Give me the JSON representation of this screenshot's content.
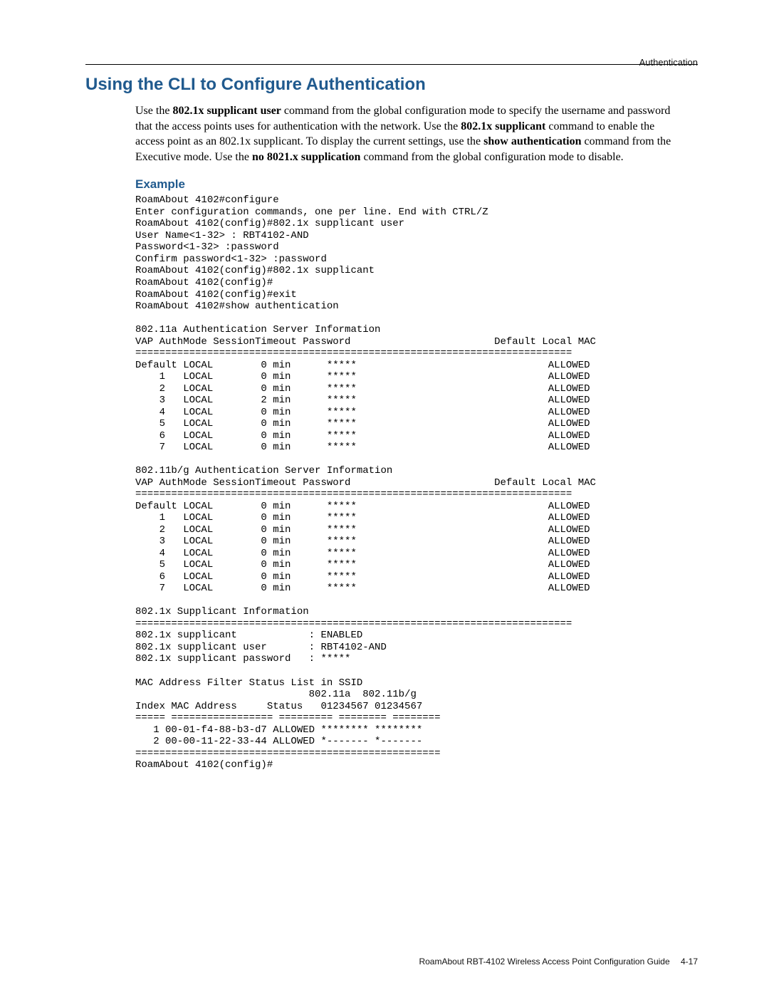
{
  "header": {
    "category": "Authentication"
  },
  "titles": {
    "section": "Using the CLI to Configure Authentication",
    "example": "Example"
  },
  "intro": {
    "p1a": "Use the ",
    "p1b": "802.1x supplicant user",
    "p1c": " command from the global configuration mode to specify the username and password that the access points uses for authentication with the network. Use the ",
    "p1d": "802.1x supplicant",
    "p1e": " command to enable the access point as an 802.1x supplicant. To display the current settings, use the ",
    "p1f": "show authentication",
    "p1g": " command from the Executive mode. Use the ",
    "p1h": "no 8021.x supplication",
    "p1i": " command from the global configuration mode to disable."
  },
  "cli": "RoamAbout 4102#configure\nEnter configuration commands, one per line. End with CTRL/Z\nRoamAbout 4102(config)#802.1x supplicant user\nUser Name<1-32> : RBT4102-AND\nPassword<1-32> :password\nConfirm password<1-32> :password\nRoamAbout 4102(config)#802.1x supplicant\nRoamAbout 4102(config)#\nRoamAbout 4102(config)#exit\nRoamAbout 4102#show authentication\n\n802.11a Authentication Server Information\nVAP AuthMode SessionTimeout Password                        Default Local MAC\n=========================================================================\nDefault LOCAL        0 min      *****                                ALLOWED\n    1   LOCAL        0 min      *****                                ALLOWED\n    2   LOCAL        0 min      *****                                ALLOWED\n    3   LOCAL        2 min      *****                                ALLOWED\n    4   LOCAL        0 min      *****                                ALLOWED\n    5   LOCAL        0 min      *****                                ALLOWED\n    6   LOCAL        0 min      *****                                ALLOWED\n    7   LOCAL        0 min      *****                                ALLOWED\n\n802.11b/g Authentication Server Information\nVAP AuthMode SessionTimeout Password                        Default Local MAC\n=========================================================================\nDefault LOCAL        0 min      *****                                ALLOWED\n    1   LOCAL        0 min      *****                                ALLOWED\n    2   LOCAL        0 min      *****                                ALLOWED\n    3   LOCAL        0 min      *****                                ALLOWED\n    4   LOCAL        0 min      *****                                ALLOWED\n    5   LOCAL        0 min      *****                                ALLOWED\n    6   LOCAL        0 min      *****                                ALLOWED\n    7   LOCAL        0 min      *****                                ALLOWED\n\n802.1x Supplicant Information\n=========================================================================\n802.1x supplicant            : ENABLED\n802.1x supplicant user       : RBT4102-AND\n802.1x supplicant password   : *****\n\nMAC Address Filter Status List in SSID\n                             802.11a  802.11b/g\nIndex MAC Address     Status   01234567 01234567\n===== ================= ========= ======== ========\n   1 00-01-f4-88-b3-d7 ALLOWED ******** ********\n   2 00-00-11-22-33-44 ALLOWED *------- *-------\n===================================================\nRoamAbout 4102(config)#",
  "footer": {
    "doc": "RoamAbout RBT-4102 Wireless Access Point Configuration Guide",
    "page": "4-17"
  }
}
